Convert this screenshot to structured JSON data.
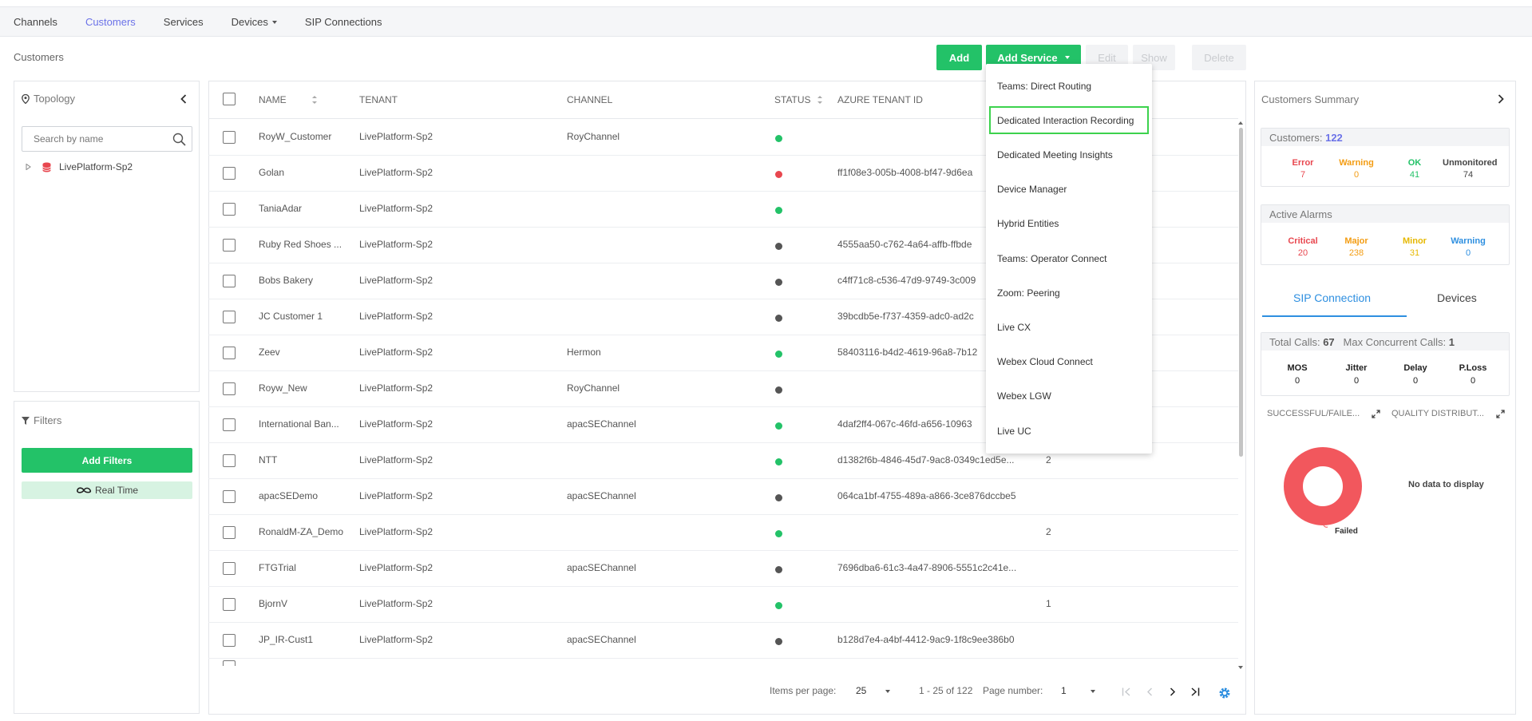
{
  "nav": {
    "items": [
      "Channels",
      "Customers",
      "Services",
      "Devices",
      "SIP Connections"
    ],
    "active": "Customers"
  },
  "page_title": "Customers",
  "toolbar": {
    "add": "Add",
    "add_service": "Add Service",
    "edit": "Edit",
    "show": "Show",
    "delete": "Delete"
  },
  "topology": {
    "title": "Topology",
    "search_placeholder": "Search by name",
    "root_node": "LivePlatform-Sp2"
  },
  "filters": {
    "title": "Filters",
    "add_button": "Add Filters",
    "realtime_label": "Real Time"
  },
  "table": {
    "columns": [
      "NAME",
      "TENANT",
      "CHANNEL",
      "STATUS",
      "AZURE TENANT ID"
    ],
    "rows": [
      {
        "name": "RoyW_Customer",
        "tenant": "LivePlatform-Sp2",
        "channel": "RoyChannel",
        "status": "green",
        "azure": "",
        "extra": ""
      },
      {
        "name": "Golan",
        "tenant": "LivePlatform-Sp2",
        "channel": "",
        "status": "red",
        "azure": "ff1f08e3-005b-4008-bf47-9d6ea",
        "extra": ""
      },
      {
        "name": "TaniaAdar",
        "tenant": "LivePlatform-Sp2",
        "channel": "",
        "status": "green",
        "azure": "",
        "extra": ""
      },
      {
        "name": "Ruby Red Shoes ...",
        "tenant": "LivePlatform-Sp2",
        "channel": "",
        "status": "gray",
        "azure": "4555aa50-c762-4a64-affb-ffbde",
        "extra": ""
      },
      {
        "name": "Bobs Bakery",
        "tenant": "LivePlatform-Sp2",
        "channel": "",
        "status": "gray",
        "azure": "c4ff71c8-c536-47d9-9749-3c009",
        "extra": ""
      },
      {
        "name": "JC Customer 1",
        "tenant": "LivePlatform-Sp2",
        "channel": "",
        "status": "gray",
        "azure": "39bcdb5e-f737-4359-adc0-ad2c",
        "extra": ""
      },
      {
        "name": "Zeev",
        "tenant": "LivePlatform-Sp2",
        "channel": "Hermon",
        "status": "green",
        "azure": "58403116-b4d2-4619-96a8-7b12",
        "extra": ""
      },
      {
        "name": "Royw_New",
        "tenant": "LivePlatform-Sp2",
        "channel": "RoyChannel",
        "status": "gray",
        "azure": "",
        "extra": ""
      },
      {
        "name": "International Ban...",
        "tenant": "LivePlatform-Sp2",
        "channel": "apacSEChannel",
        "status": "green",
        "azure": "4daf2ff4-067c-46fd-a656-10963",
        "extra": ""
      },
      {
        "name": "NTT",
        "tenant": "LivePlatform-Sp2",
        "channel": "",
        "status": "green",
        "azure": "d1382f6b-4846-45d7-9ac8-0349c1ed5e...",
        "extra": "2"
      },
      {
        "name": "apacSEDemo",
        "tenant": "LivePlatform-Sp2",
        "channel": "apacSEChannel",
        "status": "gray",
        "azure": "064ca1bf-4755-489a-a866-3ce876dccbe5",
        "extra": ""
      },
      {
        "name": "RonaldM-ZA_Demo",
        "tenant": "LivePlatform-Sp2",
        "channel": "",
        "status": "green",
        "azure": "",
        "extra": "2"
      },
      {
        "name": "FTGTrial",
        "tenant": "LivePlatform-Sp2",
        "channel": "apacSEChannel",
        "status": "gray",
        "azure": "7696dba6-61c3-4a47-8906-5551c2c41e...",
        "extra": ""
      },
      {
        "name": "BjornV",
        "tenant": "LivePlatform-Sp2",
        "channel": "",
        "status": "green",
        "azure": "",
        "extra": "1"
      },
      {
        "name": "JP_IR-Cust1",
        "tenant": "LivePlatform-Sp2",
        "channel": "apacSEChannel",
        "status": "gray",
        "azure": "b128d7e4-a4bf-4412-9ac9-1f8c9ee386b0",
        "extra": ""
      }
    ]
  },
  "pager": {
    "items_per_page_label": "Items per page:",
    "items_per_page": "25",
    "range": "1 - 25 of 122",
    "page_number_label": "Page number:",
    "page_number": "1"
  },
  "dropdown": {
    "items": [
      "Teams: Direct Routing",
      "Dedicated Interaction Recording",
      "Dedicated Meeting Insights",
      "Device Manager",
      "Hybrid Entities",
      "Teams: Operator Connect",
      "Zoom: Peering",
      "Live CX",
      "Webex Cloud Connect",
      "Webex LGW",
      "Live UC"
    ],
    "highlighted": "Dedicated Interaction Recording"
  },
  "summary": {
    "title": "Customers Summary",
    "customers_label": "Customers:",
    "customers_count": "122",
    "customer_stats": [
      {
        "label": "Error",
        "value": "7",
        "color": "#e8474f"
      },
      {
        "label": "Warning",
        "value": "0",
        "color": "#f39c12"
      },
      {
        "label": "OK",
        "value": "41",
        "color": "#23c268"
      },
      {
        "label": "Unmonitored",
        "value": "74",
        "color": "#444444"
      }
    ],
    "alarms_title": "Active Alarms",
    "alarm_stats": [
      {
        "label": "Critical",
        "value": "20",
        "color": "#e8474f"
      },
      {
        "label": "Major",
        "value": "238",
        "color": "#f39c12"
      },
      {
        "label": "Minor",
        "value": "31",
        "color": "#e6b800"
      },
      {
        "label": "Warning",
        "value": "0",
        "color": "#2e8fe0"
      }
    ],
    "tabs": [
      "SIP Connection",
      "Devices"
    ],
    "active_tab": "SIP Connection",
    "total_calls_label": "Total Calls:",
    "total_calls": "67",
    "max_calls_label": "Max Concurrent Calls:",
    "max_calls": "1",
    "quality": [
      {
        "label": "MOS",
        "value": "0"
      },
      {
        "label": "Jitter",
        "value": "0"
      },
      {
        "label": "Delay",
        "value": "0"
      },
      {
        "label": "P.Loss",
        "value": "0"
      }
    ],
    "chart1_title": "SUCCESSFUL/FAILE...",
    "chart2_title": "QUALITY DISTRIBUT...",
    "donut_label": "Failed",
    "no_data": "No data to display"
  },
  "colors": {
    "accent_green": "#23c268",
    "nav_active": "#6b72e8",
    "status_green": "#23c268",
    "status_red": "#e8474f",
    "status_gray": "#555555",
    "donut_red": "#f2575d",
    "tab_active": "#2e8fe0"
  }
}
